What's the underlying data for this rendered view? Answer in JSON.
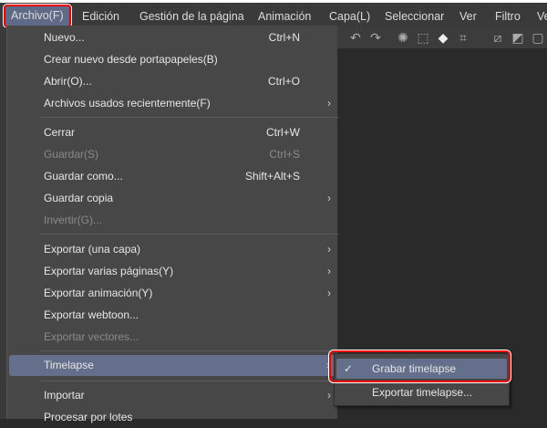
{
  "menubar": [
    "Archivo(F)",
    "Edición",
    "Gestión de la página",
    "Animación",
    "Capa(L)",
    "Seleccionar",
    "Ver",
    "Filtro",
    "Ve"
  ],
  "menu": {
    "nuevo": {
      "label": "Nuevo...",
      "shortcut": "Ctrl+N"
    },
    "crear": {
      "label": "Crear nuevo desde portapapeles(B)"
    },
    "abrir": {
      "label": "Abrir(O)...",
      "shortcut": "Ctrl+O"
    },
    "recientes": {
      "label": "Archivos usados recientemente(F)"
    },
    "cerrar": {
      "label": "Cerrar",
      "shortcut": "Ctrl+W"
    },
    "guardar": {
      "label": "Guardar(S)",
      "shortcut": "Ctrl+S"
    },
    "guardar_como": {
      "label": "Guardar como...",
      "shortcut": "Shift+Alt+S"
    },
    "guardar_copia": {
      "label": "Guardar copia"
    },
    "invertir": {
      "label": "Invertir(G)..."
    },
    "exp_capa": {
      "label": "Exportar (una capa)"
    },
    "exp_paginas": {
      "label": "Exportar varias páginas(Y)"
    },
    "exp_anim": {
      "label": "Exportar animación(Y)"
    },
    "exp_webtoon": {
      "label": "Exportar webtoon..."
    },
    "exp_vect": {
      "label": "Exportar vectores..."
    },
    "timelapse": {
      "label": "Timelapse"
    },
    "importar": {
      "label": "Importar"
    },
    "procesar": {
      "label": "Procesar por lotes"
    }
  },
  "submenu": {
    "grabar": "Grabar timelapse",
    "check": "✓",
    "exportar": "Exportar timelapse..."
  },
  "arrow": "›"
}
